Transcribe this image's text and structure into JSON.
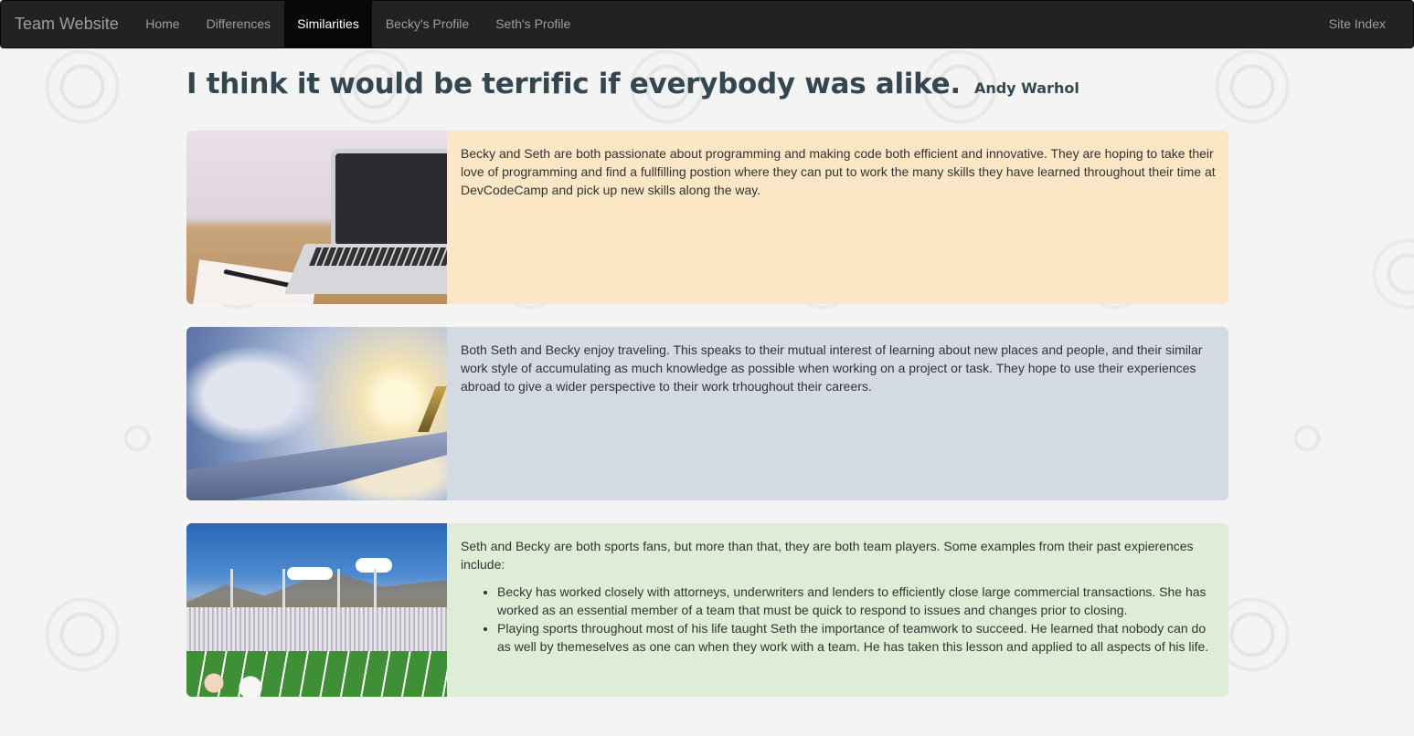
{
  "nav": {
    "brand": "Team Website",
    "items": [
      {
        "label": "Home",
        "active": false
      },
      {
        "label": "Differences",
        "active": false
      },
      {
        "label": "Similarities",
        "active": true
      },
      {
        "label": "Becky's Profile",
        "active": false
      },
      {
        "label": "Seth's Profile",
        "active": false
      }
    ],
    "right": "Site Index"
  },
  "heading": {
    "quote": "I think it would be terrific if everybody was alike.",
    "author": "Andy Warhol"
  },
  "cards": [
    {
      "image": "laptop-photo",
      "color": "#fbe6c6",
      "text": "Becky and Seth are both passionate about programming and making code both efficient and innovative. They are hoping to take their love of programming and find a fullfilling postion where they can put to work the many skills they have learned throughout their time at DevCodeCamp and pick up new skills along the way."
    },
    {
      "image": "airplane-wing-photo",
      "color": "#d4dae3",
      "text": "Both Seth and Becky enjoy traveling. This speaks to their mutual interest of learning about new places and people, and their similar work style of accumulating as much knowledge as possible when working on a project or task. They hope to use their experiences abroad to give a wider perspective to their work trhoughout their careers."
    },
    {
      "image": "stadium-photo",
      "color": "#deeed6",
      "text": "Seth and Becky are both sports fans, but more than that, they are both team players. Some examples from their past expierences include:",
      "bullets": [
        "Becky has worked closely with attorneys, underwriters and lenders to efficiently close large commercial transactions. She has worked as an essential member of a team that must be quick to respond to issues and changes prior to closing.",
        "Playing sports throughout most of his life taught Seth the importance of teamwork to succeed. He learned that nobody can do as well by themeselves as one can when they work with a team. He has taken this lesson and applied to all aspects of his life."
      ]
    }
  ]
}
